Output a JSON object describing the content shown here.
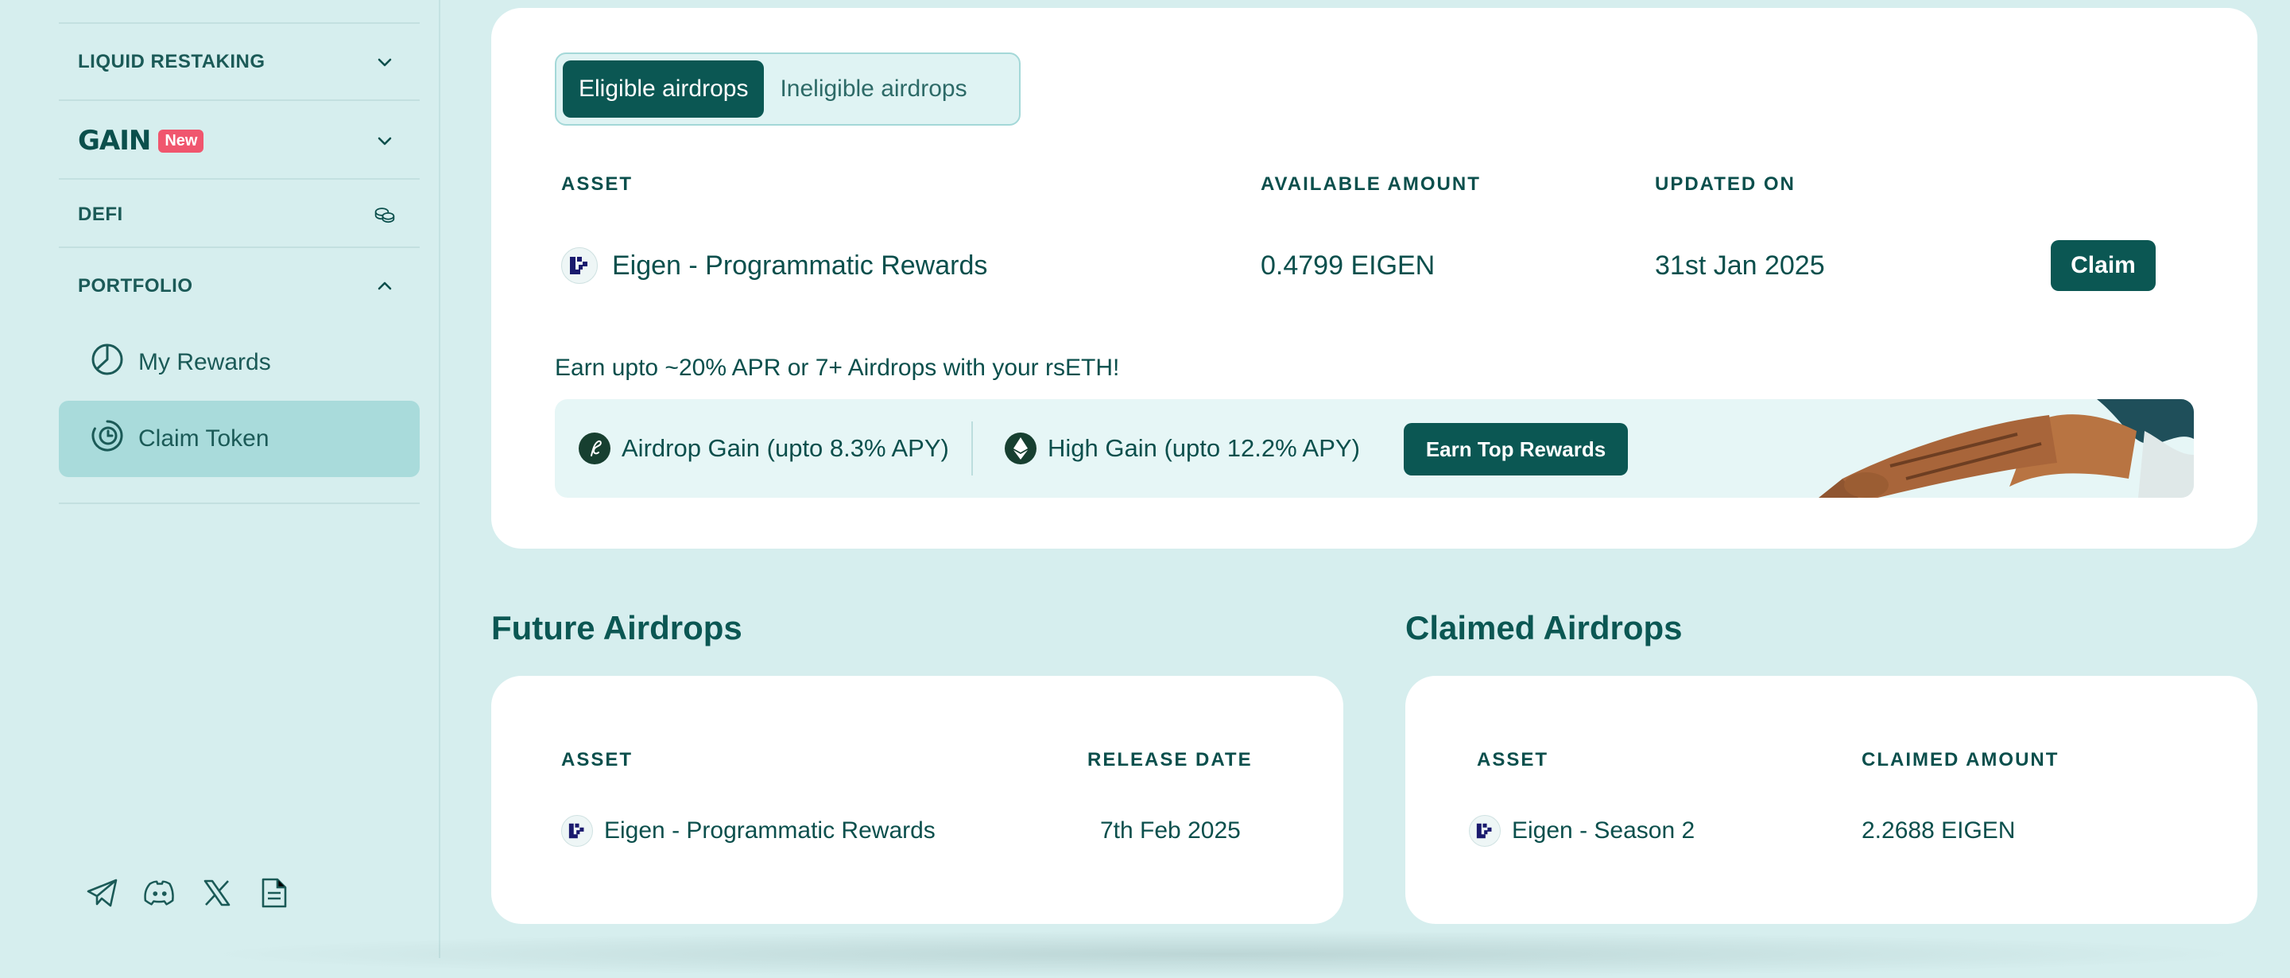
{
  "sidebar": {
    "sections": [
      {
        "label": "LIQUID RESTAKING",
        "chevron": "down"
      },
      {
        "label": "GAIN",
        "badge": "New",
        "chevron": "down"
      },
      {
        "label": "DEFI",
        "icon": "coins-icon"
      },
      {
        "label": "PORTFOLIO",
        "chevron": "up"
      }
    ],
    "items": [
      {
        "label": "My Rewards",
        "icon": "pie-chart-icon",
        "active": false
      },
      {
        "label": "Claim Token",
        "icon": "clock-coin-icon",
        "active": true
      }
    ],
    "social": [
      "telegram-icon",
      "discord-icon",
      "x-icon",
      "docs-icon"
    ]
  },
  "eligible": {
    "tabs": [
      {
        "label": "Eligible airdrops",
        "selected": true
      },
      {
        "label": "Ineligible airdrops",
        "selected": false
      }
    ],
    "headers": {
      "asset": "ASSET",
      "amount": "AVAILABLE AMOUNT",
      "updated": "UPDATED ON"
    },
    "rows": [
      {
        "asset": "Eigen - Programmatic Rewards",
        "amount": "0.4799 EIGEN",
        "updated": "31st Jan 2025",
        "action": "Claim"
      }
    ],
    "promo": {
      "text": "Earn upto ~20% APR or 7+ Airdrops with your rsETH!",
      "items": [
        "Airdrop Gain (upto 8.3% APY)",
        "High Gain (upto 12.2% APY)"
      ],
      "button": "Earn Top Rewards"
    }
  },
  "future": {
    "title": "Future Airdrops",
    "headers": {
      "asset": "ASSET",
      "date": "RELEASE DATE"
    },
    "rows": [
      {
        "asset": "Eigen - Programmatic Rewards",
        "date": "7th Feb 2025"
      }
    ]
  },
  "claimed": {
    "title": "Claimed Airdrops",
    "headers": {
      "asset": "ASSET",
      "amount": "CLAIMED AMOUNT"
    },
    "rows": [
      {
        "asset": "Eigen - Season 2",
        "amount": "2.2688 EIGEN"
      }
    ]
  },
  "colors": {
    "primary": "#0b5753",
    "background": "#d6eeee",
    "badge": "#f0566e"
  }
}
